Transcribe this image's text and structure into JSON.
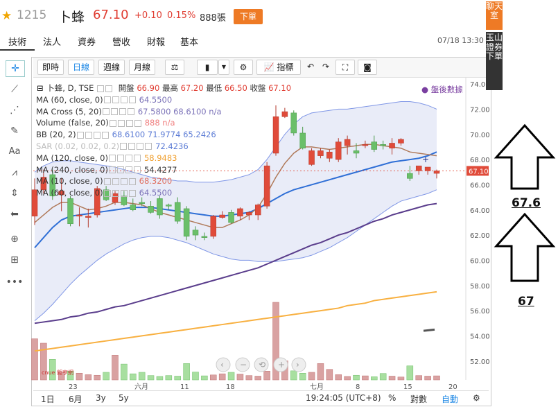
{
  "header": {
    "code": "1215",
    "name": "卜蜂",
    "price": "67.10",
    "change": "+0.10",
    "change_pct": "0.15%",
    "volume": "888張",
    "order_label": "下單"
  },
  "tabs": [
    "技術",
    "法人",
    "資券",
    "營收",
    "財報",
    "基本"
  ],
  "datetime": "07/18 13:30",
  "toolbar": {
    "intraday": "即時",
    "daily": "日線",
    "weekly": "週線",
    "monthly": "月線",
    "indicators": "指標"
  },
  "legend": {
    "title": "卜蜂, D, TSE",
    "open_label": "開盤",
    "open": "66.90",
    "high_label": "最高",
    "high": "67.20",
    "low_label": "最低",
    "low": "66.50",
    "close_label": "收盤",
    "close": "67.10",
    "after_hours": "盤後數據",
    "rows": [
      {
        "name": "MA (60, close, 0)",
        "values": "64.5500",
        "color": "#7b72b8"
      },
      {
        "name": "MA Cross (5, 20)",
        "values": "67.5800 68.6100 n/a",
        "color": "#7b72b8"
      },
      {
        "name": "Volume (false, 20)",
        "values": "888 n/a",
        "color": "#f08080"
      },
      {
        "name": "BB (20, 2)",
        "values": "68.6100 71.9774 65.2426",
        "color": "#5b7bd5"
      },
      {
        "name": "SAR (0.02, 0.02, 0.2)",
        "values": "72.4236",
        "color": "#5b7bd5"
      },
      {
        "name": "MA (120, close, 0)",
        "values": "58.9483",
        "color": "#f0a030"
      },
      {
        "name": "MA (240, close, 0)",
        "values": "54.4277",
        "color": "#333333"
      },
      {
        "name": "MA (10, close, 0)",
        "values": "68.3200",
        "color": "#e07060"
      },
      {
        "name": "MA (60, close, 0)",
        "values": "64.5500",
        "color": "#7b72b8"
      }
    ]
  },
  "y_axis": [
    "74.00",
    "72.00",
    "70.00",
    "68.00",
    "66.00",
    "64.00",
    "62.00",
    "60.00",
    "58.00",
    "56.00",
    "54.00",
    "52.00"
  ],
  "last_price_tag": "67.10",
  "x_axis": [
    "23",
    "六月",
    "11",
    "18",
    "七月",
    "8",
    "15",
    "20"
  ],
  "bottom": {
    "ranges": [
      "1日",
      "6月",
      "3y",
      "5y"
    ],
    "time": "19:24:05 (UTC+8)",
    "pct": "%",
    "log": "對數",
    "auto": "自動"
  },
  "logo_text": "cnue 鉅亨網",
  "side": {
    "chat": "聊天室",
    "trade": "玉山證券下單"
  },
  "annotations": {
    "upper": "67.6",
    "lower": "67"
  },
  "chart_data": {
    "type": "candlestick",
    "ylim": [
      50.5,
      74.5
    ],
    "candles": [
      {
        "o": 63.5,
        "h": 66.5,
        "l": 62.8,
        "c": 65.6
      },
      {
        "o": 65.6,
        "h": 67.2,
        "l": 65.3,
        "c": 66.6
      },
      {
        "o": 66.8,
        "h": 67.2,
        "l": 64.8,
        "c": 65.1
      },
      {
        "o": 65.2,
        "h": 66.5,
        "l": 63.9,
        "c": 65.5
      },
      {
        "o": 64.9,
        "h": 65.1,
        "l": 62.7,
        "c": 62.9
      },
      {
        "o": 63.5,
        "h": 64.2,
        "l": 62.7,
        "c": 63.6
      },
      {
        "o": 63.4,
        "h": 64.1,
        "l": 62.6,
        "c": 63.5
      },
      {
        "o": 63.6,
        "h": 65.9,
        "l": 63.4,
        "c": 65.7
      },
      {
        "o": 65.6,
        "h": 65.9,
        "l": 64.7,
        "c": 64.8
      },
      {
        "o": 64.6,
        "h": 65.5,
        "l": 64.4,
        "c": 65.3
      },
      {
        "o": 65.1,
        "h": 65.5,
        "l": 64.3,
        "c": 64.4
      },
      {
        "o": 64.4,
        "h": 64.9,
        "l": 63.9,
        "c": 64.0
      },
      {
        "o": 64.6,
        "h": 65.0,
        "l": 64.3,
        "c": 64.5
      },
      {
        "o": 64.3,
        "h": 64.7,
        "l": 63.7,
        "c": 63.8
      },
      {
        "o": 64.9,
        "h": 65.1,
        "l": 63.3,
        "c": 63.6
      },
      {
        "o": 64.4,
        "h": 64.5,
        "l": 64.0,
        "c": 64.3
      },
      {
        "o": 64.6,
        "h": 65.0,
        "l": 62.9,
        "c": 63.1
      },
      {
        "o": 64.1,
        "h": 64.3,
        "l": 61.6,
        "c": 61.9
      },
      {
        "o": 62.4,
        "h": 62.7,
        "l": 61.6,
        "c": 62.0
      },
      {
        "o": 61.9,
        "h": 62.2,
        "l": 61.6,
        "c": 61.8
      },
      {
        "o": 61.9,
        "h": 63.6,
        "l": 61.7,
        "c": 63.5
      },
      {
        "o": 63.4,
        "h": 63.9,
        "l": 63.3,
        "c": 63.6
      },
      {
        "o": 63.8,
        "h": 64.0,
        "l": 62.9,
        "c": 63.0
      },
      {
        "o": 63.5,
        "h": 64.2,
        "l": 63.2,
        "c": 64.1
      },
      {
        "o": 63.6,
        "h": 63.9,
        "l": 63.2,
        "c": 63.8
      },
      {
        "o": 63.6,
        "h": 64.5,
        "l": 63.2,
        "c": 64.4
      },
      {
        "o": 64.3,
        "h": 67.8,
        "l": 64.1,
        "c": 67.5
      },
      {
        "o": 68.5,
        "h": 72.3,
        "l": 68.3,
        "c": 71.4
      },
      {
        "o": 71.4,
        "h": 72.1,
        "l": 71.3,
        "c": 71.8
      },
      {
        "o": 71.7,
        "h": 71.9,
        "l": 69.9,
        "c": 70.1
      },
      {
        "o": 70.1,
        "h": 70.6,
        "l": 68.8,
        "c": 68.9
      },
      {
        "o": 67.6,
        "h": 68.9,
        "l": 67.5,
        "c": 68.7
      },
      {
        "o": 68.3,
        "h": 68.9,
        "l": 68.1,
        "c": 68.7
      },
      {
        "o": 68.1,
        "h": 68.8,
        "l": 67.8,
        "c": 68.6
      },
      {
        "o": 68.0,
        "h": 69.7,
        "l": 67.8,
        "c": 69.4
      },
      {
        "o": 69.1,
        "h": 69.9,
        "l": 68.4,
        "c": 69.6
      },
      {
        "o": 68.7,
        "h": 69.3,
        "l": 68.1,
        "c": 68.5
      },
      {
        "o": 69.1,
        "h": 69.5,
        "l": 68.9,
        "c": 69.2
      },
      {
        "o": 69.4,
        "h": 69.9,
        "l": 68.6,
        "c": 68.8
      },
      {
        "o": 69.2,
        "h": 69.5,
        "l": 68.8,
        "c": 69.1
      },
      {
        "o": 68.9,
        "h": 69.7,
        "l": 68.4,
        "c": 69.3
      },
      {
        "o": 69.3,
        "h": 69.7,
        "l": 69.1,
        "c": 69.6
      },
      {
        "o": 66.9,
        "h": 67.5,
        "l": 66.3,
        "c": 66.5
      },
      {
        "o": 67.1,
        "h": 67.5,
        "l": 66.8,
        "c": 67.5
      },
      {
        "o": 67.1,
        "h": 67.4,
        "l": 66.8,
        "c": 67.4
      },
      {
        "o": 66.9,
        "h": 67.2,
        "l": 66.5,
        "c": 67.1
      }
    ],
    "volumes": [
      1400,
      1250,
      700,
      280,
      300,
      230,
      180,
      160,
      260,
      840,
      540,
      210,
      260,
      150,
      120,
      150,
      130,
      560,
      270,
      140,
      170,
      210,
      260,
      200,
      150,
      130,
      300,
      2640,
      650,
      310,
      230,
      260,
      560,
      360,
      180,
      120,
      160,
      140,
      110,
      220,
      130,
      100,
      480,
      150,
      130,
      140
    ],
    "ma_short": [
      63.0,
      63.6,
      64.2,
      64.6,
      64.6,
      64.3,
      64.0,
      64.1,
      64.3,
      64.6,
      64.6,
      64.5,
      64.4,
      64.1,
      63.8,
      63.6,
      63.4,
      63.2,
      63.0,
      62.8,
      62.6,
      62.6,
      62.9,
      63.2,
      63.6,
      64.2,
      65.3,
      66.6,
      67.7,
      68.5,
      69.0,
      69.0,
      68.9,
      68.8,
      68.9,
      69.0,
      69.1,
      69.2,
      69.2,
      69.1,
      69.0,
      68.9,
      68.6,
      68.5,
      68.4,
      68.3
    ],
    "ma_mid": [
      61.0,
      61.8,
      62.6,
      63.2,
      63.5,
      63.6,
      63.7,
      63.8,
      63.9,
      64.0,
      64.1,
      64.2,
      64.2,
      64.2,
      64.1,
      64.0,
      63.9,
      63.8,
      63.7,
      63.6,
      63.5,
      63.5,
      63.6,
      63.7,
      63.8,
      64.1,
      64.5,
      64.9,
      65.3,
      65.6,
      65.8,
      66.0,
      66.2,
      66.4,
      66.6,
      66.8,
      67.0,
      67.2,
      67.4,
      67.6,
      67.8,
      67.9,
      68.0,
      68.1,
      68.3,
      68.6
    ],
    "ma_long": [
      55.0,
      55.1,
      55.2,
      55.3,
      55.5,
      55.6,
      55.8,
      55.9,
      56.1,
      56.3,
      56.4,
      56.6,
      56.8,
      57.0,
      57.2,
      57.4,
      57.6,
      57.8,
      58.0,
      58.2,
      58.4,
      58.6,
      58.8,
      59.0,
      59.2,
      59.4,
      59.7,
      60.0,
      60.3,
      60.6,
      60.9,
      61.2,
      61.4,
      61.7,
      62.0,
      62.2,
      62.5,
      62.8,
      63.1,
      63.3,
      63.6,
      63.8,
      64.0,
      64.2,
      64.4,
      64.5
    ],
    "ma_longest": [
      52.8,
      52.9,
      53.0,
      53.1,
      53.2,
      53.3,
      53.4,
      53.5,
      53.6,
      53.7,
      53.8,
      53.9,
      54.0,
      54.1,
      54.2,
      54.3,
      54.4,
      54.5,
      54.6,
      54.7,
      54.8,
      54.9,
      55.0,
      55.1,
      55.2,
      55.3,
      55.4,
      55.5,
      55.6,
      55.7,
      55.8,
      55.9,
      56.0,
      56.1,
      56.2,
      56.4,
      56.5,
      56.6,
      56.8,
      56.9,
      57.0,
      57.1,
      57.2,
      57.3,
      57.4,
      57.5
    ],
    "bb_upper": [
      67.0,
      67.5,
      67.8,
      67.9,
      67.9,
      67.8,
      67.7,
      67.6,
      67.5,
      67.4,
      67.2,
      67.0,
      66.8,
      66.6,
      66.5,
      66.4,
      66.3,
      66.3,
      66.2,
      66.2,
      66.2,
      66.3,
      66.4,
      66.6,
      66.8,
      67.2,
      68.0,
      69.0,
      70.0,
      70.8,
      71.4,
      71.7,
      71.8,
      71.9,
      72.0,
      72.0,
      72.1,
      72.2,
      72.3,
      72.4,
      72.5,
      72.6,
      72.6,
      72.5,
      72.3,
      72.0
    ],
    "bb_lower": [
      55.2,
      55.8,
      56.5,
      57.3,
      58.1,
      58.8,
      59.4,
      60.0,
      60.5,
      60.9,
      61.3,
      61.6,
      61.8,
      61.9,
      61.9,
      61.8,
      61.6,
      61.4,
      61.1,
      60.8,
      60.5,
      60.3,
      60.1,
      60.0,
      60.0,
      59.9,
      59.9,
      59.9,
      60.0,
      60.1,
      60.2,
      60.4,
      60.7,
      61.0,
      61.4,
      61.8,
      62.3,
      62.8,
      63.3,
      63.8,
      64.3,
      64.7,
      64.9,
      65.1,
      65.3,
      65.6
    ],
    "markers": {
      "upper": 67.6,
      "lower": 67
    }
  }
}
